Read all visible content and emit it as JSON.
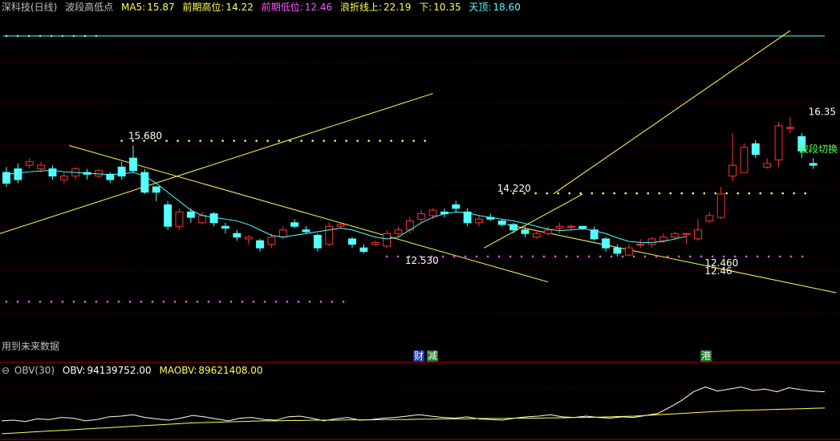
{
  "header": {
    "title": "深科技(日线)",
    "indicator_name": "波段高低点",
    "ma5_label": "MA5:",
    "ma5_value": "15.87",
    "prev_high_label": "前期高位:",
    "prev_high_value": "14.22",
    "prev_low_label": "前期低位:",
    "prev_low_value": "12.46",
    "wave_upper_label": "浪折线上:",
    "wave_upper_value": "22.19",
    "wave_lower_label": "下:",
    "wave_lower_value": "10.35",
    "top_label": "天顶:",
    "top_value": "18.60"
  },
  "notes": {
    "future_data": "用到未来数据",
    "event_cai": "财",
    "event_jian": "减",
    "event_gang": "港",
    "wave_switch": "波段切换"
  },
  "obv_header": {
    "name": "OBV(30)",
    "obv_label": "OBV:",
    "obv_value": "94139752.00",
    "maobv_label": "MAOBV:",
    "maobv_value": "89621408.00"
  },
  "colors": {
    "up": "#ff3232",
    "down": "#54ffff",
    "ma5": "#54ffff",
    "trend": "#ffff54",
    "dot_yellow": "#ffff54",
    "dot_magenta": "#ff54ff",
    "grid": "#7a0000",
    "pane_border": "#b40000",
    "obv": "#ffffff",
    "maobv": "#ffff54",
    "cyan_line": "#54ffff"
  },
  "chart_data": {
    "type": "candlestick",
    "price_range": [
      9.6,
      19.2
    ],
    "candles": [
      [
        14.8,
        14.5,
        14.95,
        14.4
      ],
      [
        14.9,
        14.6,
        15.05,
        14.5
      ],
      [
        15.0,
        15.1,
        15.2,
        14.9
      ],
      [
        14.9,
        15.0,
        15.1,
        14.8
      ],
      [
        14.9,
        14.7,
        15.0,
        14.6
      ],
      [
        14.6,
        14.7,
        14.8,
        14.5
      ],
      [
        14.7,
        14.9,
        14.95,
        14.6
      ],
      [
        14.8,
        14.75,
        14.9,
        14.6
      ],
      [
        14.7,
        14.85,
        14.9,
        14.65
      ],
      [
        14.75,
        14.6,
        14.8,
        14.5
      ],
      [
        14.95,
        14.7,
        15.1,
        14.6
      ],
      [
        15.2,
        14.85,
        15.55,
        14.8
      ],
      [
        14.8,
        14.25,
        14.9,
        14.2
      ],
      [
        14.4,
        14.25,
        14.4,
        14.0
      ],
      [
        13.9,
        13.3,
        14.0,
        13.2
      ],
      [
        13.3,
        13.7,
        13.8,
        13.2
      ],
      [
        13.7,
        13.55,
        13.8,
        13.4
      ],
      [
        13.4,
        13.6,
        13.7,
        13.35
      ],
      [
        13.65,
        13.4,
        13.7,
        13.3
      ],
      [
        13.3,
        13.25,
        13.4,
        13.1
      ],
      [
        13.1,
        13.0,
        13.2,
        12.9
      ],
      [
        12.95,
        13.0,
        13.05,
        12.8
      ],
      [
        12.9,
        12.7,
        12.95,
        12.6
      ],
      [
        12.8,
        13.0,
        13.1,
        12.7
      ],
      [
        13.0,
        13.2,
        13.3,
        12.95
      ],
      [
        13.4,
        13.3,
        13.5,
        13.25
      ],
      [
        13.2,
        13.15,
        13.3,
        13.1
      ],
      [
        13.05,
        12.7,
        13.1,
        12.6
      ],
      [
        12.8,
        13.3,
        13.4,
        12.75
      ],
      [
        13.3,
        13.35,
        13.4,
        13.25
      ],
      [
        12.95,
        12.8,
        13.0,
        12.7
      ],
      [
        12.7,
        12.6,
        12.8,
        12.55
      ],
      [
        12.8,
        12.85,
        12.9,
        12.75
      ],
      [
        12.75,
        13.1,
        13.2,
        12.7
      ],
      [
        13.1,
        13.2,
        13.3,
        13.0
      ],
      [
        13.2,
        13.45,
        13.55,
        13.1
      ],
      [
        13.5,
        13.65,
        13.75,
        13.4
      ],
      [
        13.6,
        13.75,
        13.8,
        13.5
      ],
      [
        13.7,
        13.65,
        13.8,
        13.55
      ],
      [
        13.9,
        13.8,
        14.0,
        13.7
      ],
      [
        13.7,
        13.4,
        13.8,
        13.3
      ],
      [
        13.4,
        13.5,
        13.6,
        13.3
      ],
      [
        13.55,
        13.5,
        13.65,
        13.45
      ],
      [
        13.45,
        13.35,
        13.5,
        13.3
      ],
      [
        13.35,
        13.2,
        13.4,
        13.1
      ],
      [
        13.2,
        13.1,
        13.3,
        13.0
      ],
      [
        13.0,
        13.1,
        13.2,
        12.95
      ],
      [
        13.1,
        13.2,
        13.3,
        13.05
      ],
      [
        13.25,
        13.3,
        13.4,
        13.1
      ],
      [
        13.3,
        13.3,
        13.35,
        13.2
      ],
      [
        13.3,
        13.25,
        13.3,
        13.2
      ],
      [
        13.2,
        12.95,
        13.3,
        12.9
      ],
      [
        12.95,
        12.7,
        13.0,
        12.6
      ],
      [
        12.7,
        12.55,
        12.8,
        12.46
      ],
      [
        12.5,
        12.7,
        12.8,
        12.46
      ],
      [
        12.8,
        12.8,
        12.95,
        12.7
      ],
      [
        12.8,
        12.95,
        13.0,
        12.7
      ],
      [
        12.9,
        13.0,
        13.1,
        12.85
      ],
      [
        13.0,
        13.1,
        13.15,
        12.9
      ],
      [
        13.1,
        13.1,
        13.1,
        12.8
      ],
      [
        12.95,
        13.2,
        13.5,
        12.9
      ],
      [
        13.45,
        13.6,
        13.7,
        13.4
      ],
      [
        13.55,
        14.2,
        14.4,
        13.5
      ],
      [
        14.7,
        15.0,
        15.9,
        14.55
      ],
      [
        14.8,
        15.5,
        15.6,
        14.8
      ],
      [
        15.6,
        15.3,
        15.7,
        15.2
      ],
      [
        14.95,
        15.05,
        15.2,
        14.9
      ],
      [
        15.15,
        16.1,
        16.2,
        14.95
      ],
      [
        16.05,
        16.05,
        16.35,
        15.9
      ],
      [
        15.8,
        15.4,
        15.9,
        15.2
      ],
      [
        15.05,
        15.0,
        15.2,
        14.9
      ]
    ],
    "ma5": [
      14.75,
      14.78,
      14.82,
      14.84,
      14.86,
      14.82,
      14.8,
      14.78,
      14.76,
      14.74,
      14.76,
      14.8,
      14.7,
      14.5,
      14.25,
      14.0,
      13.75,
      13.6,
      13.55,
      13.5,
      13.45,
      13.35,
      13.2,
      13.05,
      13.0,
      13.05,
      13.1,
      13.15,
      13.2,
      13.25,
      13.2,
      13.1,
      13.0,
      12.95,
      13.0,
      13.2,
      13.4,
      13.55,
      13.65,
      13.7,
      13.68,
      13.6,
      13.55,
      13.5,
      13.45,
      13.38,
      13.3,
      13.22,
      13.18,
      13.2,
      13.23,
      13.18,
      13.1,
      12.98,
      12.88,
      12.85,
      12.85,
      12.88,
      12.95,
      13.02
    ],
    "wave_points": [
      {
        "label": "15.680",
        "value": 15.68
      },
      {
        "label": "12.530",
        "value": 12.53
      },
      {
        "label": "14.220",
        "value": 14.22
      },
      {
        "label": "12.460",
        "value": 12.46
      },
      {
        "label": "12.46",
        "value": 12.46
      },
      {
        "label": "16.35",
        "value": 16.35
      }
    ],
    "levels": {
      "ma5": 15.87,
      "prev_high": 14.22,
      "prev_low": 12.46,
      "wave_upper": 22.19,
      "wave_lower": 10.35,
      "top": 18.6
    },
    "obv": {
      "series": [
        2.5,
        2.6,
        2.4,
        2.8,
        2.7,
        3.0,
        2.9,
        2.5,
        2.7,
        3.1,
        3.2,
        3.4,
        3.0,
        2.8,
        2.6,
        2.9,
        3.3,
        3.1,
        2.8,
        2.5,
        2.9,
        3.0,
        2.7,
        2.6,
        3.1,
        3.2,
        2.9,
        2.5,
        2.8,
        3.0,
        2.6,
        2.7,
        2.9,
        3.0,
        3.2,
        3.4,
        3.2,
        3.0,
        2.9,
        3.1,
        2.8,
        2.7,
        2.6,
        2.9,
        3.1,
        3.2,
        3.4,
        3.1,
        3.0,
        3.2,
        3.0,
        2.9,
        3.1,
        3.0,
        3.3,
        3.6,
        4.5,
        5.5,
        6.8,
        7.5,
        6.9,
        7.2,
        7.5,
        7.0,
        7.2,
        6.8,
        7.4,
        7.1,
        6.9,
        6.8
      ],
      "maobv": [
        0.6,
        0.7,
        0.8,
        0.9,
        1.0,
        1.1,
        1.2,
        1.3,
        1.4,
        1.5,
        1.6,
        1.7,
        1.8,
        1.9,
        2.0,
        2.1,
        2.2,
        2.25,
        2.3,
        2.35,
        2.4,
        2.45,
        2.5,
        2.5,
        2.55,
        2.55,
        2.6,
        2.6,
        2.6,
        2.65,
        2.65,
        2.65,
        2.7,
        2.7,
        2.7,
        2.75,
        2.75,
        2.8,
        2.8,
        2.8,
        2.85,
        2.85,
        2.85,
        2.9,
        2.9,
        2.9,
        2.95,
        2.95,
        3.0,
        3.0,
        3.05,
        3.1,
        3.15,
        3.2,
        3.3,
        3.4,
        3.5,
        3.6,
        3.7,
        3.8,
        3.9,
        4.0,
        4.05,
        4.1,
        4.15,
        4.2,
        4.25,
        4.3,
        4.35,
        4.4
      ],
      "range": [
        0,
        9
      ]
    }
  }
}
